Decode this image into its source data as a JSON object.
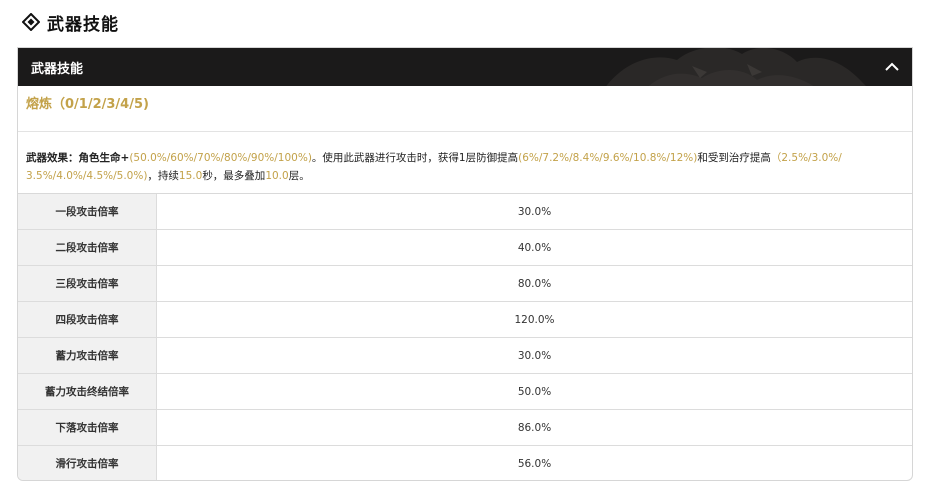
{
  "header": {
    "title": "武器技能",
    "icon": "diamond-icon"
  },
  "panel": {
    "bar_title": "武器技能",
    "collapse_icon": "chevron-up-icon",
    "refine_label": "熔炼（0/1/2/3/4/5)",
    "effect": {
      "p1": "武器效果：角色生命+",
      "p2": "(50.0%/60%/70%/80%/90%/100%)",
      "p3": "。使用此武器进行攻击时，获得1层防御提高",
      "p4": "(6%/7.2%/8.4%/9.6%/10.8%/12%)",
      "p5": "和受到治疗提高",
      "p6": "（2.5%/3.0%/",
      "p7": "3.5%/4.0%/4.5%/5.0%)",
      "p8": "，持续",
      "p9": "15.0",
      "p10": "秒，最多叠加",
      "p11": "10.0",
      "p12": "层。"
    },
    "rows": [
      {
        "name": "一段攻击倍率",
        "value": "30.0%"
      },
      {
        "name": "二段攻击倍率",
        "value": "40.0%"
      },
      {
        "name": "三段攻击倍率",
        "value": "80.0%"
      },
      {
        "name": "四段攻击倍率",
        "value": "120.0%"
      },
      {
        "name": "蓄力攻击倍率",
        "value": "30.0%"
      },
      {
        "name": "蓄力攻击终结倍率",
        "value": "50.0%"
      },
      {
        "name": "下落攻击倍率",
        "value": "86.0%"
      },
      {
        "name": "滑行攻击倍率",
        "value": "56.0%"
      }
    ]
  },
  "colors": {
    "accent_gold": "#c3a24a",
    "bar_bg": "#1b1a1a"
  }
}
